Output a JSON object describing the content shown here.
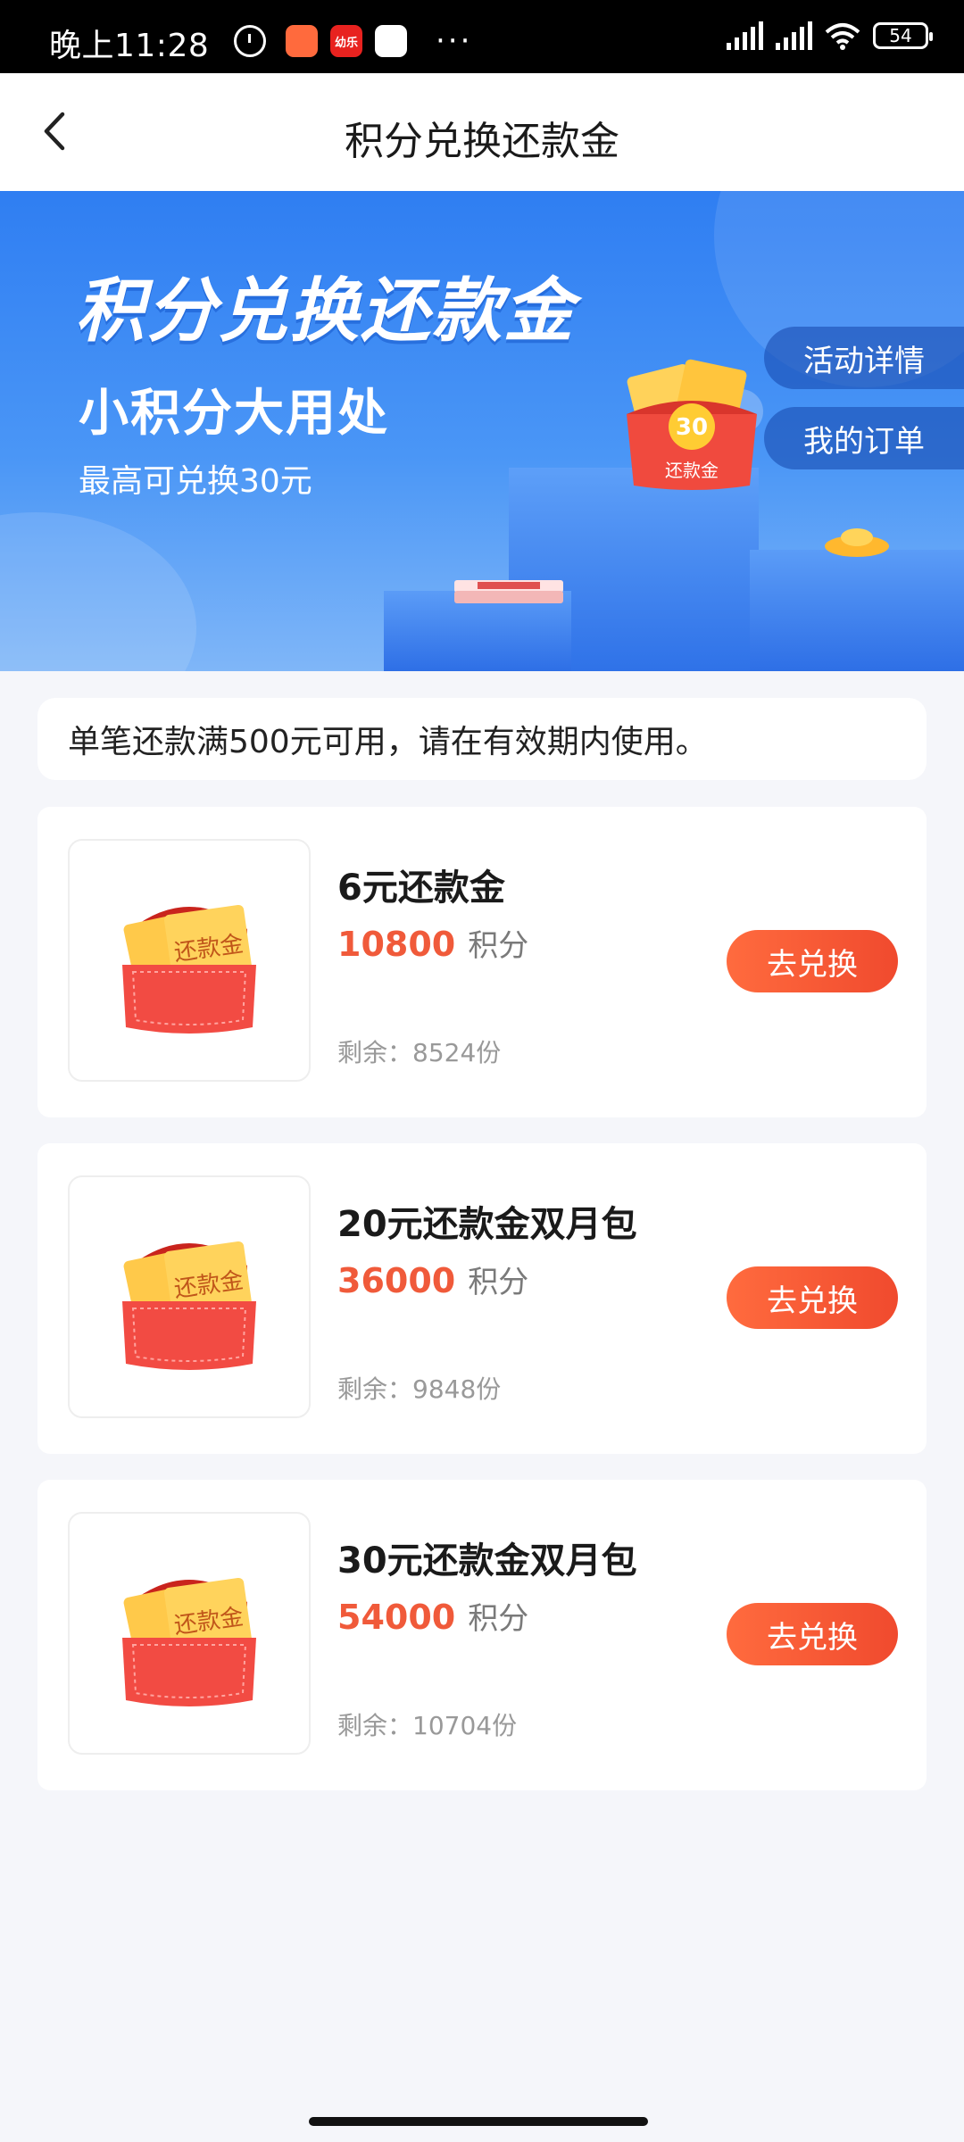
{
  "status_bar": {
    "time": "晚上11:28",
    "app_icon_1": "",
    "app_icon_2": "幼乐",
    "app_icon_3": "",
    "more": "···",
    "battery": "54"
  },
  "header": {
    "title": "积分兑换还款金"
  },
  "banner": {
    "title": "积分兑换还款金",
    "subtitle": "小积分大用处",
    "desc": "最高可兑换30元",
    "activity_details": "活动详情",
    "my_orders": "我的订单",
    "badge_amount": "30",
    "badge_label": "还款金"
  },
  "notice": {
    "text": "单笔还款满500元可用，请在有效期内使用。"
  },
  "items": [
    {
      "name": "6元还款金",
      "points": "10800",
      "points_unit": "积分",
      "stock": "剩余：8524份",
      "button": "去兑换",
      "ticket_label": "还款金"
    },
    {
      "name": "20元还款金双月包",
      "points": "36000",
      "points_unit": "积分",
      "stock": "剩余：9848份",
      "button": "去兑换",
      "ticket_label": "还款金"
    },
    {
      "name": "30元还款金双月包",
      "points": "54000",
      "points_unit": "积分",
      "stock": "剩余：10704份",
      "button": "去兑换",
      "ticket_label": "还款金"
    }
  ],
  "colors": {
    "accent": "#f05a3a",
    "banner_blue": "#2f7ef2",
    "button_gradient_start": "#ff6b3e"
  }
}
